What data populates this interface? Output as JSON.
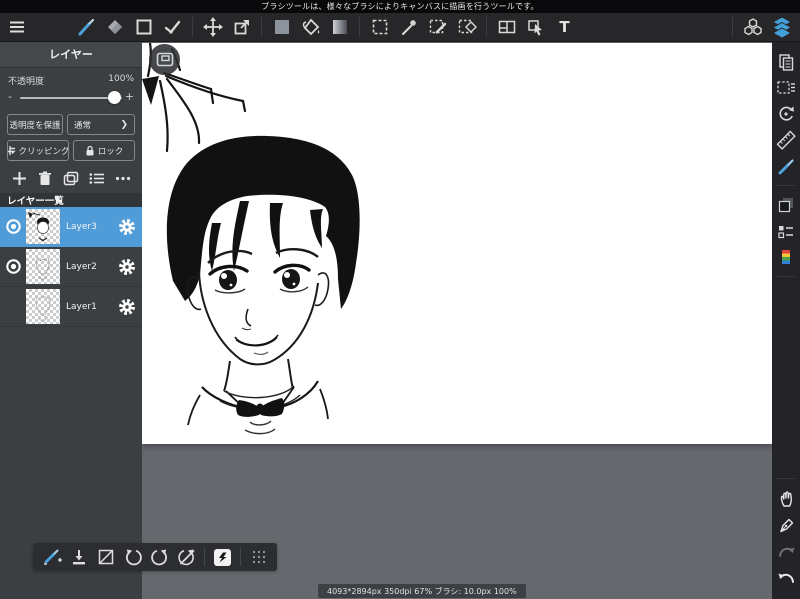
{
  "notification": {
    "text": "ブラシツールは、様々なブラシによりキャンバスに描画を行うツールです。"
  },
  "toolbar": {
    "text_tool_label": "T"
  },
  "layer_panel": {
    "title": "レイヤー",
    "opacity_label": "不透明度",
    "opacity_value": "100%",
    "opacity_percent": 100,
    "slider_minus": "-",
    "slider_plus": "+",
    "protect_button_label": "透明度を保護",
    "blend_mode_label": "通常",
    "blend_chevron": "❯",
    "clipping_button_label": "クリッピング",
    "lock_button_label": "ロック",
    "list_header": "レイヤー一覧",
    "layers": [
      {
        "name": "Layer3",
        "selected": true,
        "visible": true
      },
      {
        "name": "Layer2",
        "selected": false,
        "visible": true
      },
      {
        "name": "Layer1",
        "selected": false,
        "visible": false
      }
    ]
  },
  "status_bar": {
    "text": "4093*2894px 350dpi 67% ブラシ: 10.0px 100%"
  },
  "canvas": {
    "zoom_percent": 67,
    "size": "4093*2894px",
    "dpi": "350dpi",
    "brush_size": "10.0px"
  },
  "colors": {
    "accent_blue": "#4aa3db",
    "selected_layer_bg": "#4f9cd8",
    "canvas_surround": "#65686d",
    "panel_bg": "#3c3f42",
    "toolbar_bg": "#27272a"
  },
  "icons": {
    "menu": "hamburger",
    "brush": "blue-diagonal-brush",
    "eraser": "diamond",
    "shape": "square-outline",
    "polyline": "check-nodes",
    "move": "four-arrows",
    "transform": "square-arrow-out",
    "fill-swatch": "gray-square",
    "bucket": "paint-bucket",
    "gradient": "gradient-square",
    "select": "dashed-square",
    "magic-wand": "wand-sparkle",
    "select-pen": "dashed-square-pen",
    "select-eraser": "dashed-square-diamond",
    "panel-divide": "split-frame",
    "operation": "cursor-frame",
    "text": "T",
    "material": "hexagon-cluster",
    "layers": "blue-stack",
    "visibility": "eye",
    "settings": "gear",
    "add": "plus",
    "delete": "trash",
    "duplicate": "two-pages",
    "list": "dotted-list",
    "more": "ellipsis",
    "clipping": "clip-mark",
    "lock": "padlock",
    "pages": "documents",
    "select-panel": "dashed-square-lines",
    "rotate-reset": "circular-arrow-dot",
    "ruler": "diagonal-ruler",
    "brush-material": "blue-brush",
    "swatch": "stacked-squares",
    "snap": "square-list",
    "palette": "rainbow-bar",
    "hand": "open-hand",
    "pen": "pen-nib",
    "redo": "arrow-right-curve",
    "undo": "arrow-left-curve",
    "brush-add": "brush-plus",
    "save": "arrow-into-tray",
    "flip-none": "square-diagonal",
    "rotate-ccw": "arrow-ccw",
    "rotate-cw": "arrow-cw",
    "rotate-off": "arrow-cw-slash",
    "invert": "white-chip-bolt",
    "grid": "dot-grid",
    "window": "rounded-frame"
  }
}
